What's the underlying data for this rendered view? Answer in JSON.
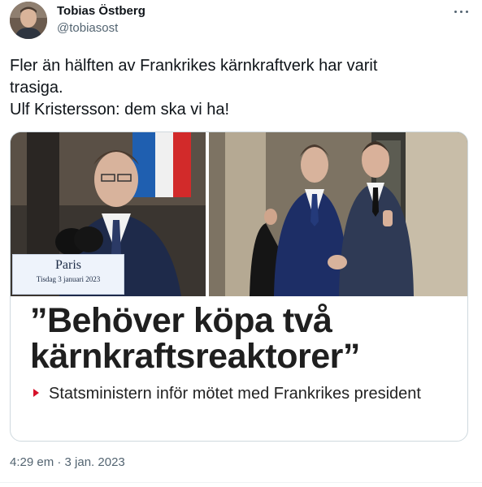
{
  "author": {
    "display_name": "Tobias Östberg",
    "handle": "@tobiasost"
  },
  "tweet": {
    "text_lines": [
      "Fler än hälften av Frankrikes kärnkraftverk har varit",
      "trasiga.",
      "Ulf Kristersson: dem ska vi ha!"
    ],
    "timestamp": "4:29 em · 3 jan. 2023"
  },
  "card": {
    "sign_city": "Paris",
    "sign_date": "Tisdag 3 januari 2023",
    "headline_lines": [
      "”Behöver köpa två",
      "kärnkraftsreaktorer”"
    ],
    "subline": "Statsministern inför mötet med Frankrikes president",
    "accent_color": "#d6112a"
  },
  "icons": {
    "more": "more-icon",
    "avatar": "avatar"
  }
}
